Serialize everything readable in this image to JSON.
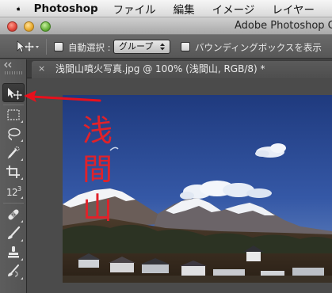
{
  "menubar": {
    "app_name": "Photoshop",
    "items": [
      "ファイル",
      "編集",
      "イメージ",
      "レイヤー"
    ]
  },
  "window": {
    "title": "Adobe Photoshop C"
  },
  "options_bar": {
    "auto_select_label": "自動選択 :",
    "auto_select_value": "グループ",
    "bounding_box_label": "バウンディングボックスを表示"
  },
  "document_tab": {
    "close_glyph": "×",
    "title": "浅間山噴火写真.jpg @ 100% (浅間山, RGB/8) *"
  },
  "photo": {
    "overlay_text": [
      "浅",
      "間",
      "山"
    ]
  },
  "tools": [
    {
      "name": "move-tool",
      "icon": "move-icon",
      "active": true
    },
    {
      "name": "marquee-tool",
      "icon": "marquee-icon",
      "active": false
    },
    {
      "name": "lasso-tool",
      "icon": "lasso-icon",
      "active": false
    },
    {
      "name": "quick-selection-tool",
      "icon": "quick-selection-icon",
      "active": false
    },
    {
      "name": "crop-tool",
      "icon": "crop-icon",
      "active": false
    },
    {
      "name": "count-tool",
      "icon": "count-icon",
      "label": "1,2,3",
      "active": false
    },
    {
      "name": "healing-brush-tool",
      "icon": "bandage-icon",
      "active": false
    },
    {
      "name": "brush-tool",
      "icon": "brush-icon",
      "active": false
    },
    {
      "name": "stamp-tool",
      "icon": "stamp-icon",
      "active": false
    },
    {
      "name": "history-brush-tool",
      "icon": "history-brush-icon",
      "active": false
    }
  ],
  "colors": {
    "annotation_arrow": "#e8101c",
    "overlay_text": "#e0222a"
  }
}
